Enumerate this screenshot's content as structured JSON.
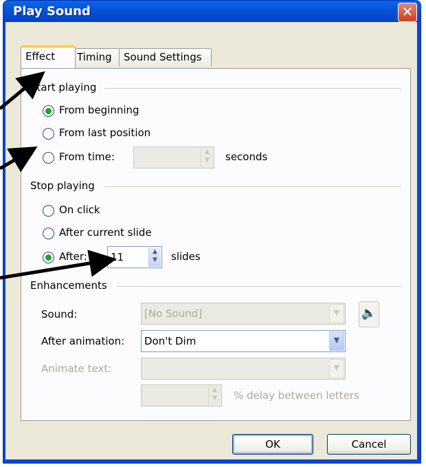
{
  "window": {
    "title": "Play Sound"
  },
  "tabs": [
    {
      "label": "Effect",
      "active": true
    },
    {
      "label": "Timing",
      "active": false
    },
    {
      "label": "Sound Settings",
      "active": false
    }
  ],
  "start_playing": {
    "label": "Start playing",
    "from_beginning": "From beginning",
    "from_last_position": "From last position",
    "from_time": "From time:",
    "from_time_value": "",
    "seconds_label": "seconds",
    "selected": "from_beginning"
  },
  "stop_playing": {
    "label": "Stop playing",
    "on_click": "On click",
    "after_current_slide": "After current slide",
    "after": "After:",
    "after_value": "11",
    "slides_label": "slides",
    "selected": "after"
  },
  "enhancements": {
    "label": "Enhancements",
    "sound_label": "Sound:",
    "sound_value": "[No Sound]",
    "after_animation_label": "After animation:",
    "after_animation_value": "Don't Dim",
    "animate_text_label": "Animate text:",
    "animate_text_value": "",
    "delay_value": "",
    "delay_label": "% delay between letters"
  },
  "buttons": {
    "ok": "OK",
    "cancel": "Cancel"
  },
  "icons": {
    "close": "close-icon",
    "speaker": "speaker-icon",
    "spin": "spin-arrows-icon",
    "dropdown": "chevron-down-icon"
  },
  "colors": {
    "titlebar": "#0a46d8",
    "dialog_bg": "#ece9d8",
    "panel_bg": "#fcfcfe",
    "tab_highlight": "#ffc83c",
    "radio_dot": "#21a121"
  }
}
